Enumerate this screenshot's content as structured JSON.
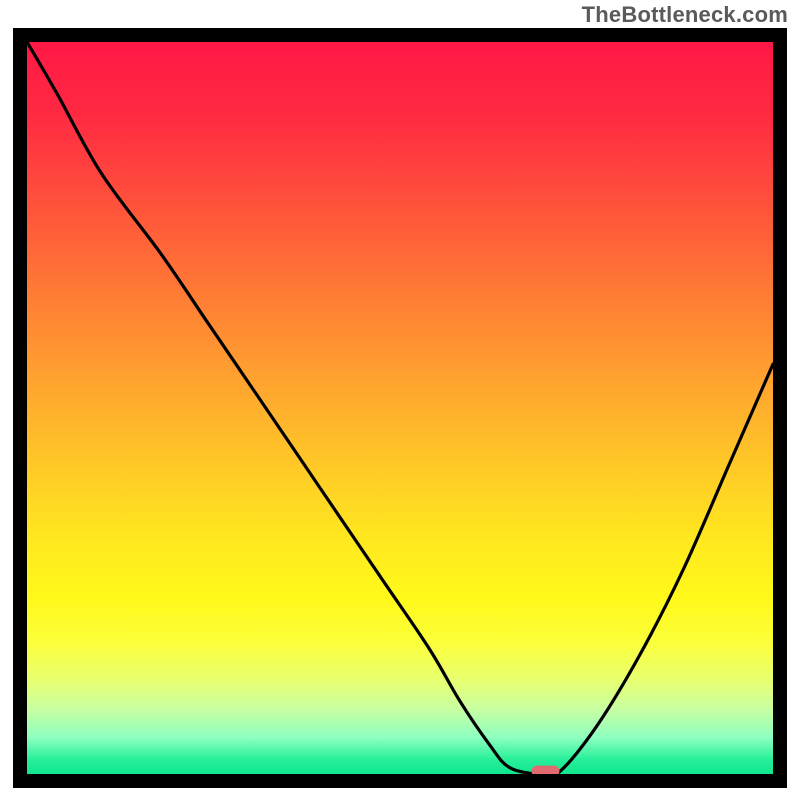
{
  "watermark": "TheBottleneck.com",
  "chart_data": {
    "type": "line",
    "title": "",
    "xlabel": "",
    "ylabel": "",
    "xlim": [
      0,
      100
    ],
    "ylim": [
      0,
      100
    ],
    "grid": false,
    "legend": false,
    "series": [
      {
        "name": "bottleneck-curve",
        "x": [
          0,
          4,
          10,
          18,
          24,
          30,
          36,
          42,
          48,
          54,
          58,
          62,
          64.5,
          68,
          71,
          76,
          82,
          88,
          94,
          100
        ],
        "y": [
          100,
          93,
          82,
          71,
          62,
          53,
          44,
          35,
          26,
          17,
          10,
          4,
          1,
          0,
          0,
          6,
          16,
          28,
          42,
          56
        ]
      }
    ],
    "marker": {
      "x": 69.5,
      "y": 0.4,
      "color": "#e06a6f",
      "label": "optimal-point"
    },
    "gradient_stops": [
      {
        "pos": 0,
        "color": "#ff1846"
      },
      {
        "pos": 22,
        "color": "#ff513b"
      },
      {
        "pos": 46,
        "color": "#ffa22f"
      },
      {
        "pos": 68,
        "color": "#ffe81f"
      },
      {
        "pos": 87,
        "color": "#e9ff6e"
      },
      {
        "pos": 100,
        "color": "#10e58e"
      }
    ]
  }
}
